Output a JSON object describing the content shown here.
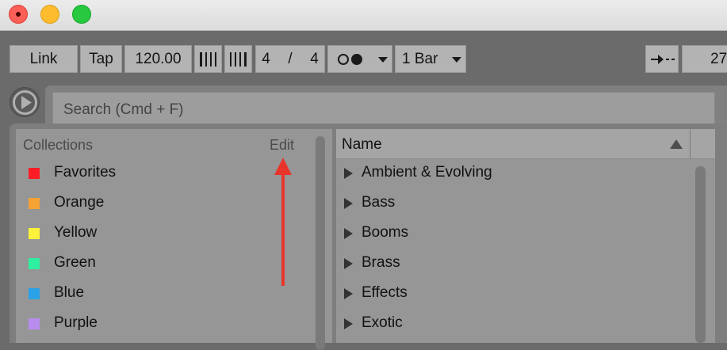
{
  "window": {
    "controls": [
      "close-button",
      "minimize-button",
      "zoom-button"
    ],
    "colors": {
      "close": "#fc5f57",
      "minimize": "#fdbc2e",
      "zoom": "#28c840"
    }
  },
  "transport": {
    "link_label": "Link",
    "tap_label": "Tap",
    "tempo": "120.00",
    "nudge_down_icon": "nudge-down-icon",
    "nudge_up_icon": "nudge-up-icon",
    "sig_numerator": "4",
    "sig_separator": "/",
    "sig_denominator": "4",
    "metronome_icon": "metronome-icon",
    "quantize": "1 Bar",
    "follow_icon": "follow-arrow-icon",
    "position_partial": "27"
  },
  "browser": {
    "search_placeholder": "Search (Cmd + F)",
    "collections": {
      "header": "Collections",
      "edit_label": "Edit",
      "items": [
        {
          "label": "Favorites",
          "color": "#ff1d25"
        },
        {
          "label": "Orange",
          "color": "#f7a334"
        },
        {
          "label": "Yellow",
          "color": "#fdf23a"
        },
        {
          "label": "Green",
          "color": "#2df0a0"
        },
        {
          "label": "Blue",
          "color": "#2aa2e8"
        },
        {
          "label": "Purple",
          "color": "#b98cf0"
        }
      ]
    },
    "content": {
      "column_header": "Name",
      "items": [
        {
          "label": "Ambient & Evolving"
        },
        {
          "label": "Bass"
        },
        {
          "label": "Booms"
        },
        {
          "label": "Brass"
        },
        {
          "label": "Effects"
        },
        {
          "label": "Exotic"
        }
      ]
    }
  },
  "annotation": {
    "color": "#e8352b"
  }
}
